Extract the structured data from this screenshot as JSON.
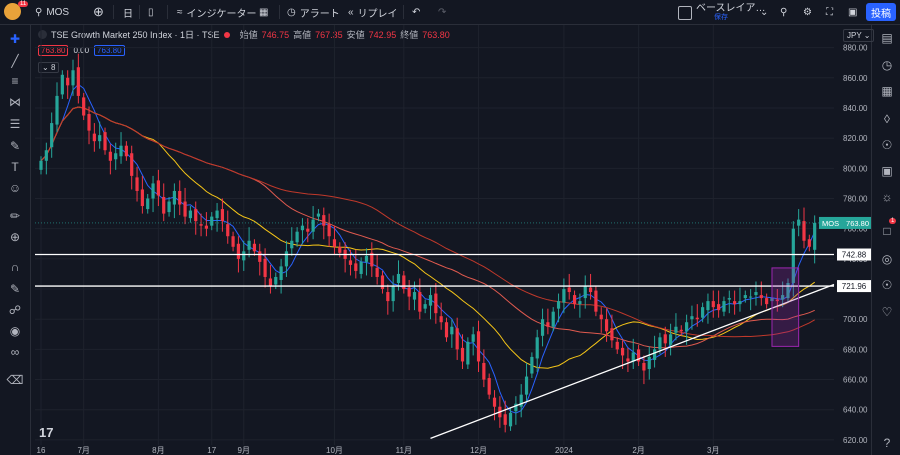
{
  "toolbar": {
    "badge_count": "11",
    "symbol": "MOS",
    "interval": "日",
    "indicators": "インジケーター",
    "alert": "アラート",
    "replay": "リプレイ",
    "layout_name": "ベースレイア…",
    "layout_saved": "保存",
    "post_label": "投稿"
  },
  "legend": {
    "title": "TSE Growth Market 250 Index · 1日 · TSE",
    "open_label": "始値",
    "open": "746.75",
    "high_label": "高値",
    "high": "767.35",
    "low_label": "安値",
    "low": "742.95",
    "close_label": "終値",
    "close": "763.80",
    "price_box": "763.80",
    "change": "0.00",
    "price_box2": "763.80",
    "indicators_count": "8"
  },
  "currency": "JPY",
  "right_badge": "1",
  "colors": {
    "background": "#131722",
    "up": "#26a69a",
    "down": "#f23645",
    "ma_fast": "#2962ff",
    "ma_mid": "#f5c518",
    "ma_slow": "#e05a4f",
    "ma_slow2": "#c0392b",
    "box": "#9c27b0"
  },
  "chart_data": {
    "type": "candlestick",
    "symbol": "MOS",
    "ylim": [
      610,
      895
    ],
    "y_ticks": [
      620,
      640,
      660,
      680,
      700,
      720,
      740,
      760,
      780,
      800,
      820,
      840,
      860,
      880
    ],
    "x_ticks": [
      "16",
      "7月",
      "8月",
      "17",
      "9月",
      "10月",
      "11月",
      "12月",
      "2024",
      "2月",
      "3月"
    ],
    "last_price_label": "MOS",
    "last_price": "763.80",
    "horizontal_lines": [
      {
        "price": 742.88,
        "label": "742.88"
      },
      {
        "price": 721.96,
        "label": "721.96"
      }
    ],
    "trendline": {
      "from": [
        "2023-10-03",
        621
      ],
      "to": [
        "2024-02-26",
        723
      ]
    },
    "closes": [
      805,
      812,
      830,
      848,
      862,
      855,
      865,
      848,
      835,
      825,
      818,
      822,
      812,
      805,
      810,
      815,
      808,
      795,
      785,
      775,
      780,
      790,
      782,
      770,
      778,
      785,
      776,
      768,
      772,
      765,
      762,
      760,
      768,
      772,
      765,
      755,
      748,
      740,
      745,
      752,
      745,
      738,
      728,
      722,
      728,
      735,
      745,
      752,
      758,
      762,
      758,
      766,
      770,
      762,
      755,
      748,
      744,
      740,
      736,
      732,
      738,
      742,
      735,
      728,
      720,
      712,
      722,
      730,
      720,
      715,
      718,
      705,
      710,
      716,
      704,
      698,
      688,
      695,
      680,
      672,
      685,
      690,
      672,
      660,
      650,
      642,
      635,
      630,
      638,
      644,
      650,
      662,
      675,
      688,
      700,
      695,
      705,
      712,
      720,
      718,
      710,
      712,
      722,
      718,
      705,
      700,
      692,
      686,
      680,
      676,
      672,
      678,
      672,
      666,
      675,
      680,
      688,
      684,
      690,
      695,
      692,
      698,
      702,
      700,
      708,
      712,
      708,
      706,
      712,
      714,
      710,
      712,
      716,
      715,
      718,
      714,
      710,
      714,
      712,
      716,
      724,
      760,
      766,
      752,
      748,
      763.8
    ]
  }
}
